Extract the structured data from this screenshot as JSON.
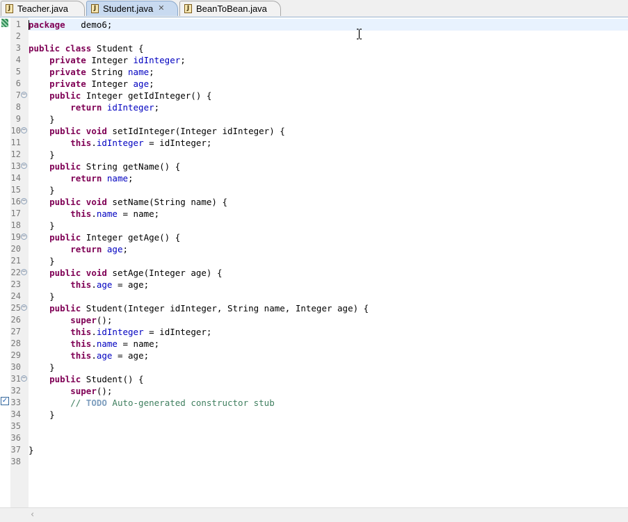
{
  "tabs": [
    {
      "label": "Teacher.java",
      "active": false
    },
    {
      "label": "Student.java",
      "active": true
    },
    {
      "label": "BeanToBean.java",
      "active": false
    }
  ],
  "icons": {
    "file": "java-file-icon",
    "close": "close-icon",
    "fold": "fold-minus-icon",
    "task": "task-checkbox-icon"
  },
  "colors": {
    "keyword": "#7f0055",
    "field": "#0000c0",
    "comment": "#3f7f5f",
    "todo": "#7f9fbf",
    "current_line": "#e8f2fe"
  },
  "editor": {
    "current_line": 1,
    "lines": [
      {
        "num": "1",
        "fold": false,
        "tokens": [
          [
            "kw",
            "package"
          ],
          [
            "",
            "   demo6;"
          ]
        ]
      },
      {
        "num": "2",
        "fold": false,
        "tokens": []
      },
      {
        "num": "3",
        "fold": false,
        "tokens": [
          [
            "kw",
            "public"
          ],
          [
            "",
            " "
          ],
          [
            "kw",
            "class"
          ],
          [
            "",
            " Student {"
          ]
        ]
      },
      {
        "num": "4",
        "fold": false,
        "tokens": [
          [
            "",
            "    "
          ],
          [
            "kw",
            "private"
          ],
          [
            "",
            " Integer "
          ],
          [
            "fld",
            "idInteger"
          ],
          [
            "",
            ";"
          ]
        ]
      },
      {
        "num": "5",
        "fold": false,
        "tokens": [
          [
            "",
            "    "
          ],
          [
            "kw",
            "private"
          ],
          [
            "",
            " String "
          ],
          [
            "fld",
            "name"
          ],
          [
            "",
            ";"
          ]
        ]
      },
      {
        "num": "6",
        "fold": false,
        "tokens": [
          [
            "",
            "    "
          ],
          [
            "kw",
            "private"
          ],
          [
            "",
            " Integer "
          ],
          [
            "fld",
            "age"
          ],
          [
            "",
            ";"
          ]
        ]
      },
      {
        "num": "7",
        "fold": true,
        "tokens": [
          [
            "",
            "    "
          ],
          [
            "kw",
            "public"
          ],
          [
            "",
            " Integer getIdInteger() {"
          ]
        ]
      },
      {
        "num": "8",
        "fold": false,
        "tokens": [
          [
            "",
            "        "
          ],
          [
            "kw",
            "return"
          ],
          [
            "",
            " "
          ],
          [
            "fld",
            "idInteger"
          ],
          [
            "",
            ";"
          ]
        ]
      },
      {
        "num": "9",
        "fold": false,
        "tokens": [
          [
            "",
            "    }"
          ]
        ]
      },
      {
        "num": "10",
        "fold": true,
        "tokens": [
          [
            "",
            "    "
          ],
          [
            "kw",
            "public"
          ],
          [
            "",
            " "
          ],
          [
            "kw",
            "void"
          ],
          [
            "",
            " setIdInteger(Integer idInteger) {"
          ]
        ]
      },
      {
        "num": "11",
        "fold": false,
        "tokens": [
          [
            "",
            "        "
          ],
          [
            "kw",
            "this"
          ],
          [
            "",
            "."
          ],
          [
            "fld",
            "idInteger"
          ],
          [
            "",
            " = idInteger;"
          ]
        ]
      },
      {
        "num": "12",
        "fold": false,
        "tokens": [
          [
            "",
            "    }"
          ]
        ]
      },
      {
        "num": "13",
        "fold": true,
        "tokens": [
          [
            "",
            "    "
          ],
          [
            "kw",
            "public"
          ],
          [
            "",
            " String getName() {"
          ]
        ]
      },
      {
        "num": "14",
        "fold": false,
        "tokens": [
          [
            "",
            "        "
          ],
          [
            "kw",
            "return"
          ],
          [
            "",
            " "
          ],
          [
            "fld",
            "name"
          ],
          [
            "",
            ";"
          ]
        ]
      },
      {
        "num": "15",
        "fold": false,
        "tokens": [
          [
            "",
            "    }"
          ]
        ]
      },
      {
        "num": "16",
        "fold": true,
        "tokens": [
          [
            "",
            "    "
          ],
          [
            "kw",
            "public"
          ],
          [
            "",
            " "
          ],
          [
            "kw",
            "void"
          ],
          [
            "",
            " setName(String name) {"
          ]
        ]
      },
      {
        "num": "17",
        "fold": false,
        "tokens": [
          [
            "",
            "        "
          ],
          [
            "kw",
            "this"
          ],
          [
            "",
            "."
          ],
          [
            "fld",
            "name"
          ],
          [
            "",
            " = name;"
          ]
        ]
      },
      {
        "num": "18",
        "fold": false,
        "tokens": [
          [
            "",
            "    }"
          ]
        ]
      },
      {
        "num": "19",
        "fold": true,
        "tokens": [
          [
            "",
            "    "
          ],
          [
            "kw",
            "public"
          ],
          [
            "",
            " Integer getAge() {"
          ]
        ]
      },
      {
        "num": "20",
        "fold": false,
        "tokens": [
          [
            "",
            "        "
          ],
          [
            "kw",
            "return"
          ],
          [
            "",
            " "
          ],
          [
            "fld",
            "age"
          ],
          [
            "",
            ";"
          ]
        ]
      },
      {
        "num": "21",
        "fold": false,
        "tokens": [
          [
            "",
            "    }"
          ]
        ]
      },
      {
        "num": "22",
        "fold": true,
        "tokens": [
          [
            "",
            "    "
          ],
          [
            "kw",
            "public"
          ],
          [
            "",
            " "
          ],
          [
            "kw",
            "void"
          ],
          [
            "",
            " setAge(Integer age) {"
          ]
        ]
      },
      {
        "num": "23",
        "fold": false,
        "tokens": [
          [
            "",
            "        "
          ],
          [
            "kw",
            "this"
          ],
          [
            "",
            "."
          ],
          [
            "fld",
            "age"
          ],
          [
            "",
            " = age;"
          ]
        ]
      },
      {
        "num": "24",
        "fold": false,
        "tokens": [
          [
            "",
            "    }"
          ]
        ]
      },
      {
        "num": "25",
        "fold": true,
        "tokens": [
          [
            "",
            "    "
          ],
          [
            "kw",
            "public"
          ],
          [
            "",
            " Student(Integer idInteger, String name, Integer age) {"
          ]
        ]
      },
      {
        "num": "26",
        "fold": false,
        "tokens": [
          [
            "",
            "        "
          ],
          [
            "kw",
            "super"
          ],
          [
            "",
            "();"
          ]
        ]
      },
      {
        "num": "27",
        "fold": false,
        "tokens": [
          [
            "",
            "        "
          ],
          [
            "kw",
            "this"
          ],
          [
            "",
            "."
          ],
          [
            "fld",
            "idInteger"
          ],
          [
            "",
            " = idInteger;"
          ]
        ]
      },
      {
        "num": "28",
        "fold": false,
        "tokens": [
          [
            "",
            "        "
          ],
          [
            "kw",
            "this"
          ],
          [
            "",
            "."
          ],
          [
            "fld",
            "name"
          ],
          [
            "",
            " = name;"
          ]
        ]
      },
      {
        "num": "29",
        "fold": false,
        "tokens": [
          [
            "",
            "        "
          ],
          [
            "kw",
            "this"
          ],
          [
            "",
            "."
          ],
          [
            "fld",
            "age"
          ],
          [
            "",
            " = age;"
          ]
        ]
      },
      {
        "num": "30",
        "fold": false,
        "tokens": [
          [
            "",
            "    }"
          ]
        ]
      },
      {
        "num": "31",
        "fold": true,
        "tokens": [
          [
            "",
            "    "
          ],
          [
            "kw",
            "public"
          ],
          [
            "",
            " Student() {"
          ]
        ]
      },
      {
        "num": "32",
        "fold": false,
        "tokens": [
          [
            "",
            "        "
          ],
          [
            "kw",
            "super"
          ],
          [
            "",
            "();"
          ]
        ]
      },
      {
        "num": "33",
        "fold": false,
        "tokens": [
          [
            "",
            "        "
          ],
          [
            "cmt",
            "// "
          ],
          [
            "todo",
            "TODO"
          ],
          [
            "cmt",
            " Auto-generated constructor stub"
          ]
        ]
      },
      {
        "num": "34",
        "fold": false,
        "tokens": [
          [
            "",
            "    }"
          ]
        ]
      },
      {
        "num": "35",
        "fold": false,
        "tokens": []
      },
      {
        "num": "36",
        "fold": false,
        "tokens": []
      },
      {
        "num": "37",
        "fold": false,
        "tokens": [
          [
            "",
            "}"
          ]
        ]
      },
      {
        "num": "38",
        "fold": false,
        "tokens": []
      }
    ]
  },
  "scrollbar": {
    "left_arrow": "‹"
  }
}
